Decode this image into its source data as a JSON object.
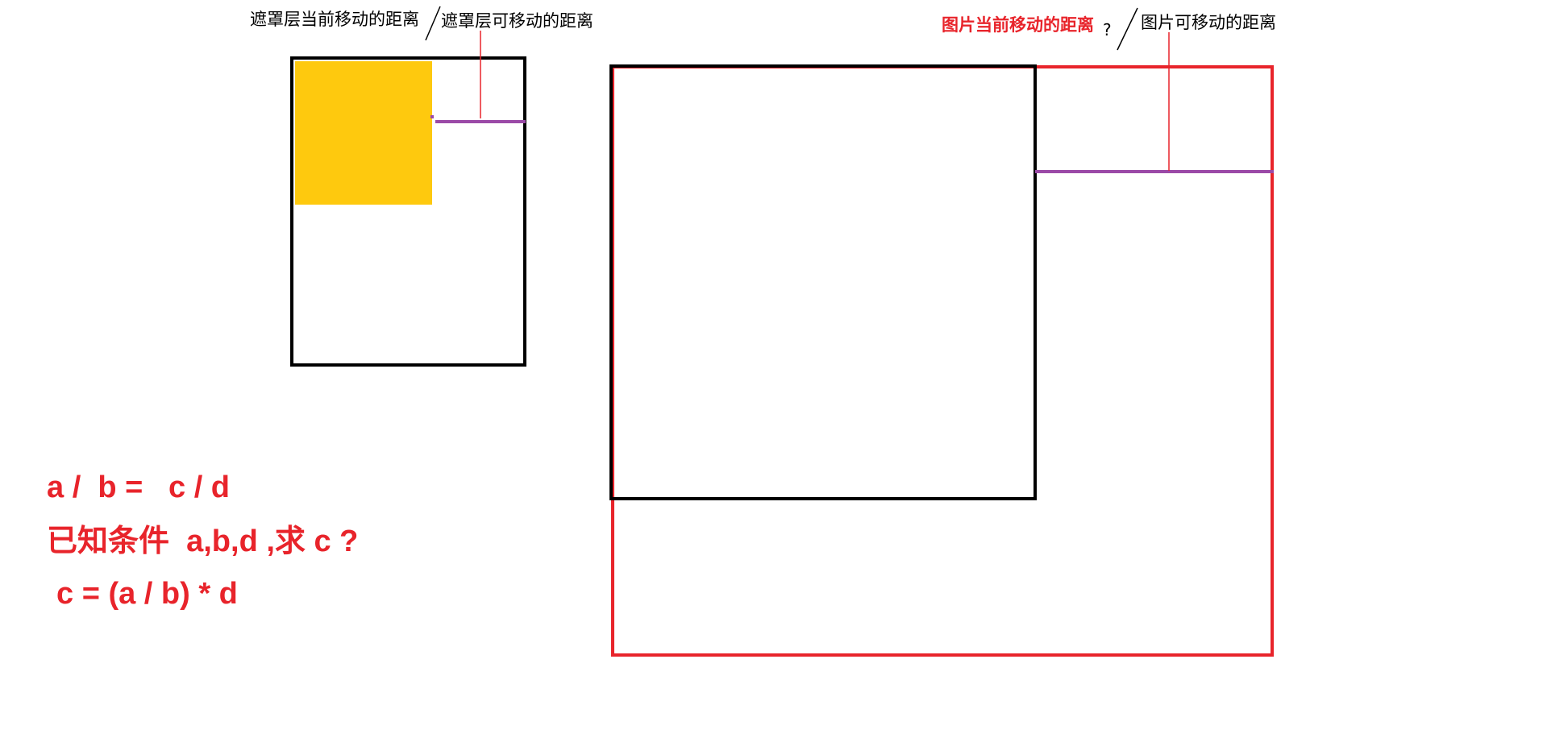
{
  "labels": {
    "mask_current": "遮罩层当前移动的距离",
    "mask_movable": "遮罩层可移动的距离",
    "img_current": "图片当前移动的距离",
    "img_question": "?",
    "img_movable": "图片可移动的距离"
  },
  "formulas": {
    "line1": "a /  b =   c / d",
    "line2": "已知条件  a,b,d ,求 c ?",
    "line3": "c = (a / b) * d"
  },
  "colors": {
    "red": "#e8242b",
    "black": "#000000",
    "yellow": "#fec90e",
    "purple": "#9b4aa7",
    "pink_line": "#e8242b"
  }
}
